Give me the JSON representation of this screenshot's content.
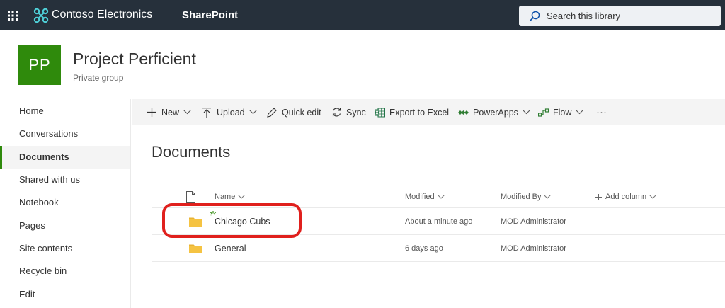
{
  "suite_bar": {
    "waffle_icon": "waffle-icon",
    "brand_name": "Contoso Electronics",
    "app_name": "SharePoint",
    "search_placeholder": "Search this library"
  },
  "site": {
    "logo_initials": "PP",
    "logo_color": "#2f8a0c",
    "title": "Project Perficient",
    "subtitle": "Private group"
  },
  "left_nav": {
    "items": [
      {
        "label": "Home"
      },
      {
        "label": "Conversations"
      },
      {
        "label": "Documents",
        "selected": true
      },
      {
        "label": "Shared with us"
      },
      {
        "label": "Notebook"
      },
      {
        "label": "Pages"
      },
      {
        "label": "Site contents"
      },
      {
        "label": "Recycle bin"
      },
      {
        "label": "Edit"
      }
    ]
  },
  "command_bar": {
    "new": "New",
    "upload": "Upload",
    "quick_edit": "Quick edit",
    "sync": "Sync",
    "export_to_excel": "Export to Excel",
    "powerapps": "PowerApps",
    "flow": "Flow",
    "more": "···"
  },
  "library": {
    "title": "Documents",
    "columns": {
      "name": "Name",
      "modified": "Modified",
      "modified_by": "Modified By",
      "add_column": "Add column"
    },
    "rows": [
      {
        "name": "Chicago Cubs",
        "modified": "About a minute ago",
        "modified_by": "MOD Administrator",
        "highlighted": true
      },
      {
        "name": "General",
        "modified": "6 days ago",
        "modified_by": "MOD Administrator"
      }
    ]
  },
  "colors": {
    "suite_bar": "#26303b",
    "accent": "#2f8a0c",
    "highlight": "#e0201d",
    "folder": "#f5c342"
  }
}
